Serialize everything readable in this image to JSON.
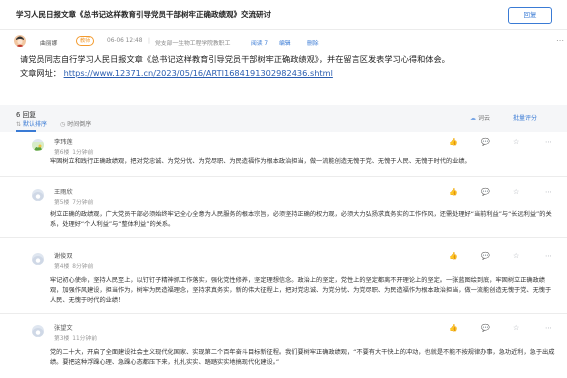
{
  "topic": {
    "title": "学习人民日报文章《总书记这样教育引导党员干部树牢正确政绩观》交流研讨",
    "reply_label": "回复"
  },
  "post": {
    "author": "曲丽娜",
    "role": "教师",
    "date": "06-06 12:48",
    "dept": "党支部一生物工程学院教职工",
    "views": "阅读 7",
    "edit_label": "编辑",
    "delete_label": "删除",
    "more_icon": "more-horizontal-icon",
    "body": "请党员同志自行学习人民日报文章《总书记这样教育引导党员干部树牢正确政绩观》，并在留言区发表学习心得和体会。",
    "url_prefix": "文章网址：",
    "url": "https://www.12371.cn/2023/05/16/ARTI1684191302982436.shtml"
  },
  "list": {
    "count_label": "6 回复",
    "sort_options": [
      "默认排序",
      "时间倒序"
    ],
    "wordcloud_label": "词云",
    "batch_score_label": "批量评分"
  },
  "replies": [
    {
      "name": "李玮莲",
      "floor": "第6楼",
      "time": "1分钟前",
      "content": "牢固树立和践行正确政绩观，把对党忠诚、为党分忧、为党尽职、为民造福作为根本政治担当，做一流能创造无愧于党、无愧于人民、无愧于时代的业绩。"
    },
    {
      "name": "王雨欣",
      "floor": "第5楼",
      "time": "7分钟前",
      "content": "树立正确的政绩观，广大党员干部必须始终牢记全心全意为人民服务的根本宗旨，必须坚持正确的权力观，必须大力弘扬求真务实的工作作风，还需处理好“当前利益”与“长远利益”的关系，处理好“个人利益”与“整体利益”的关系。"
    },
    {
      "name": "谢俊双",
      "floor": "第4楼",
      "time": "8分钟前",
      "content": "牢记初心使命，坚持人民至上，以钉钉子精神抓工作落实，强化党性修养，坚定理想信念。政治上的坚定，党性上的坚定都离不开理论上的坚定。一张蓝图绘到底，牢固树立正确政绩观，加强作风建设，担当作为，树牢为民造福理念，坚持求真务实，新的伟大征程上，把对党忠诚、为党分忧、为党尽职、为民造福作为根本政治担当，做一流能创造无愧于党、无愧于人民、无愧于时代的业绩！"
    },
    {
      "name": "张望文",
      "floor": "第3楼",
      "time": "11分钟前",
      "content": "党的二十大，开启了全面建设社会主义现代化国家、实现第二个百年奋斗目标新征程。我们要树牢正确政绩观，“不要有大干快上的冲动，也就是不能不按规律办事，急功近利，急于出成绩。要把这种浮躁心理、急躁心态都压下来，扎扎实实、踏踏实实地搞现代化建设。”"
    }
  ],
  "colors": {
    "accent": "#3a7bd5",
    "badge": "#f39b2f"
  }
}
